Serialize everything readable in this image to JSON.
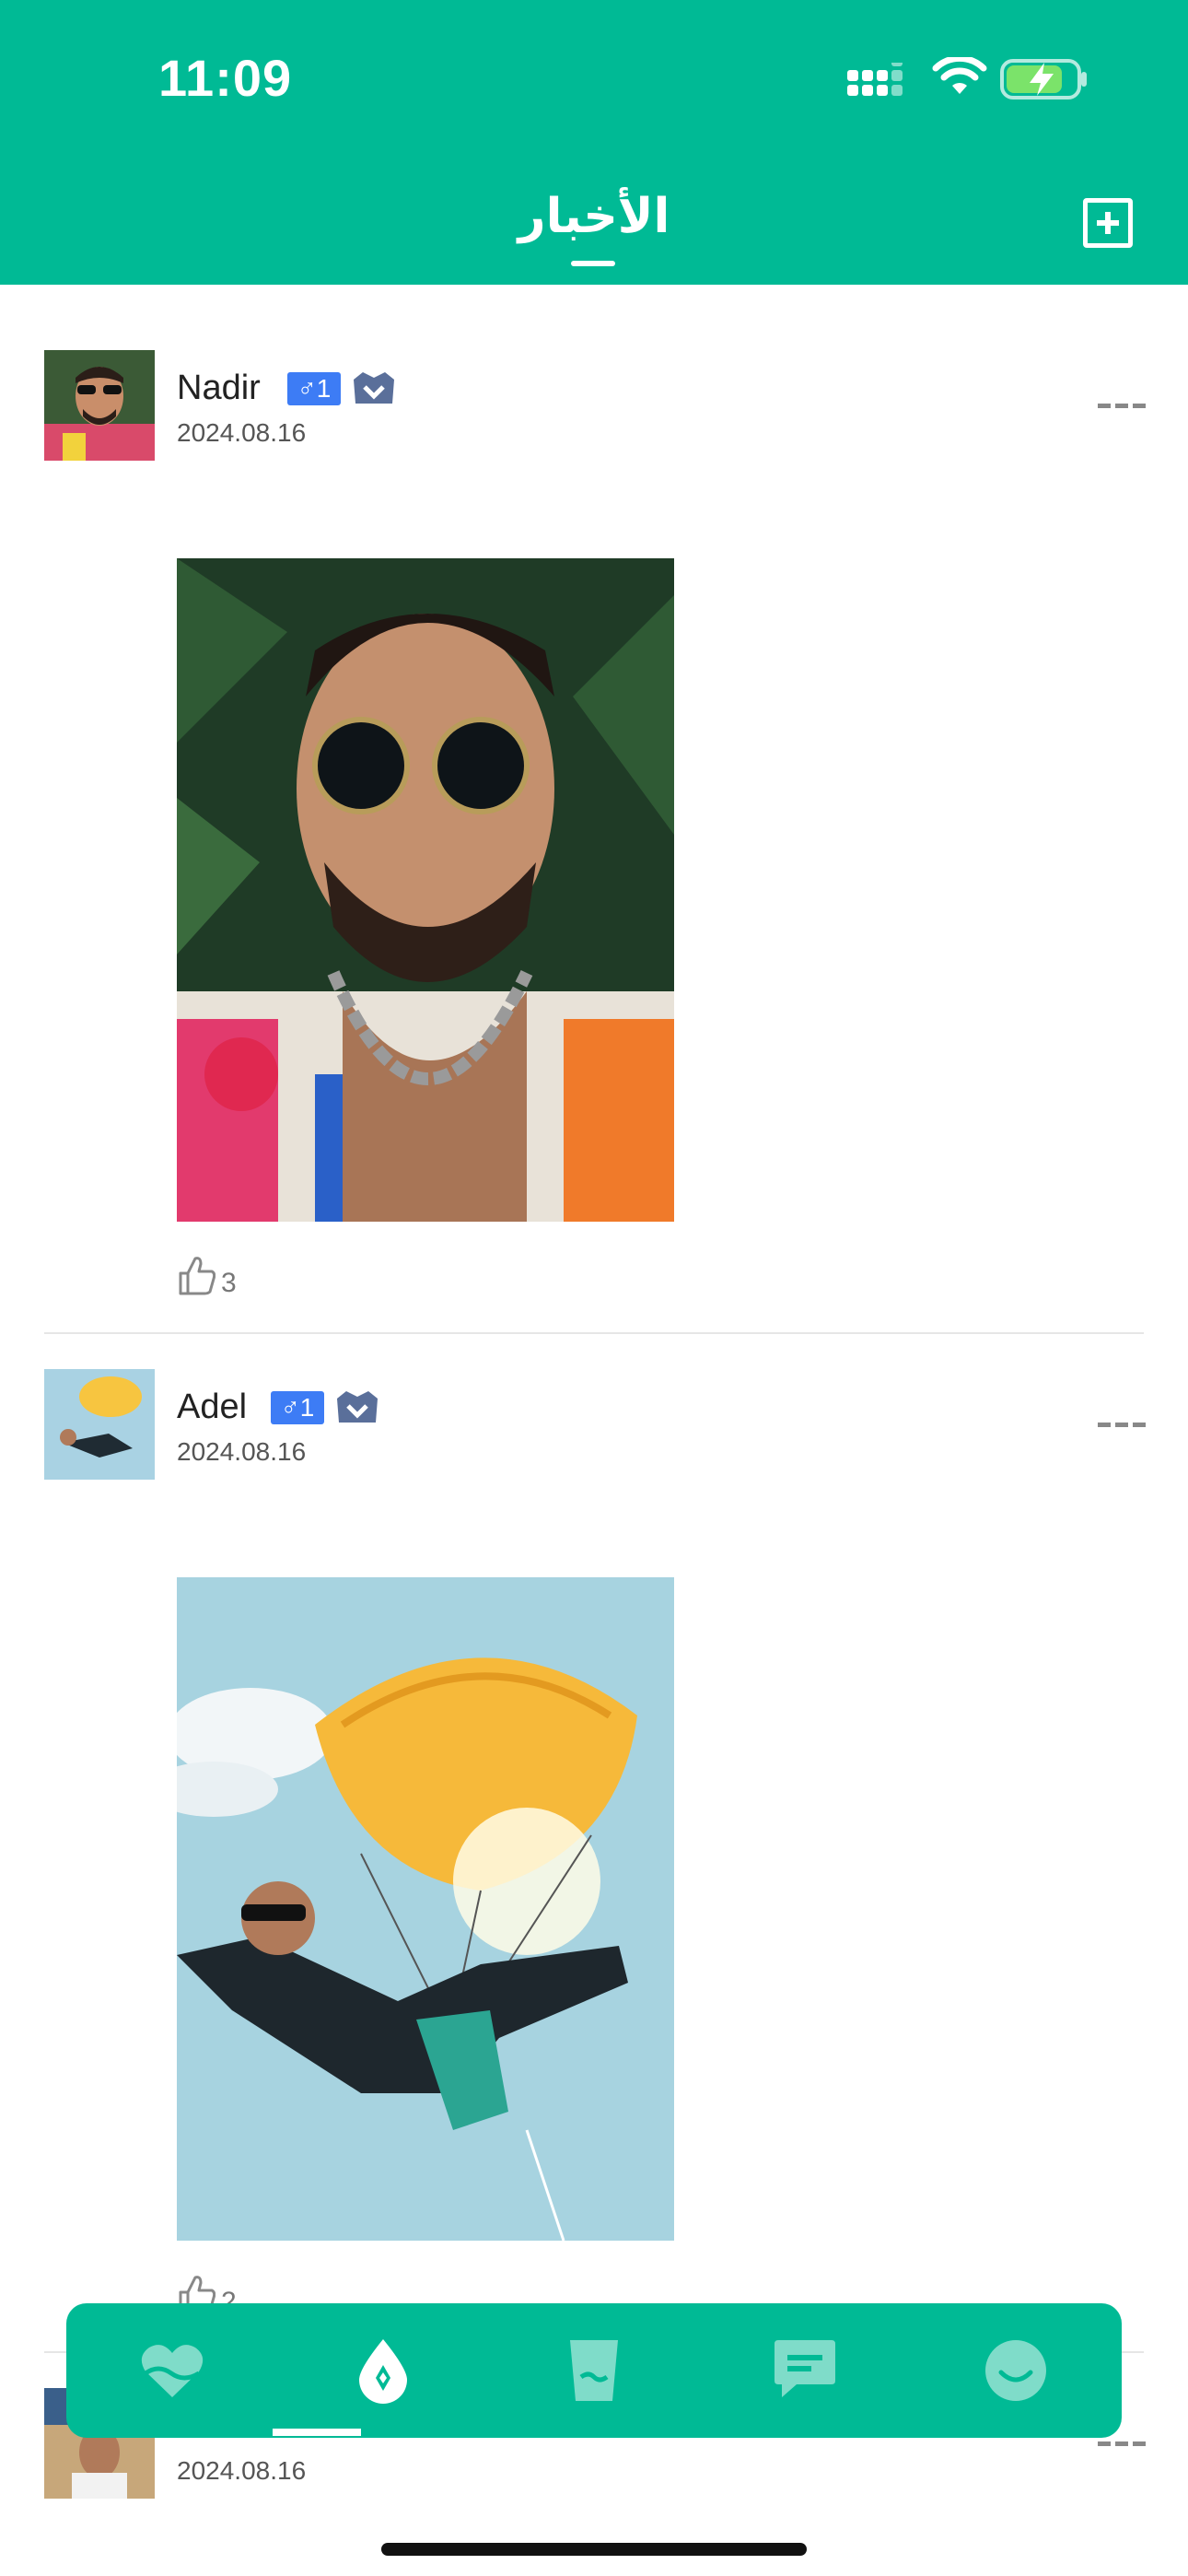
{
  "status_bar": {
    "time": "11:09"
  },
  "header": {
    "title": "الأخبار"
  },
  "posts": [
    {
      "name": "Nadir",
      "gender_badge": "♂1",
      "date": "2024.08.16",
      "likes": "3"
    },
    {
      "name": "Adel",
      "gender_badge": "♂1",
      "date": "2024.08.16",
      "likes": "2"
    },
    {
      "name": "",
      "gender_badge": "",
      "date": "2024.08.16",
      "likes": ""
    }
  ],
  "tabs": [
    {
      "icon": "heart-icon"
    },
    {
      "icon": "drop-icon",
      "active": true
    },
    {
      "icon": "cup-icon"
    },
    {
      "icon": "message-icon"
    },
    {
      "icon": "smile-icon"
    }
  ],
  "colors": {
    "accent": "#00BA95",
    "gender_badge": "#3D7CF5",
    "vip": "#5A6F9A"
  }
}
